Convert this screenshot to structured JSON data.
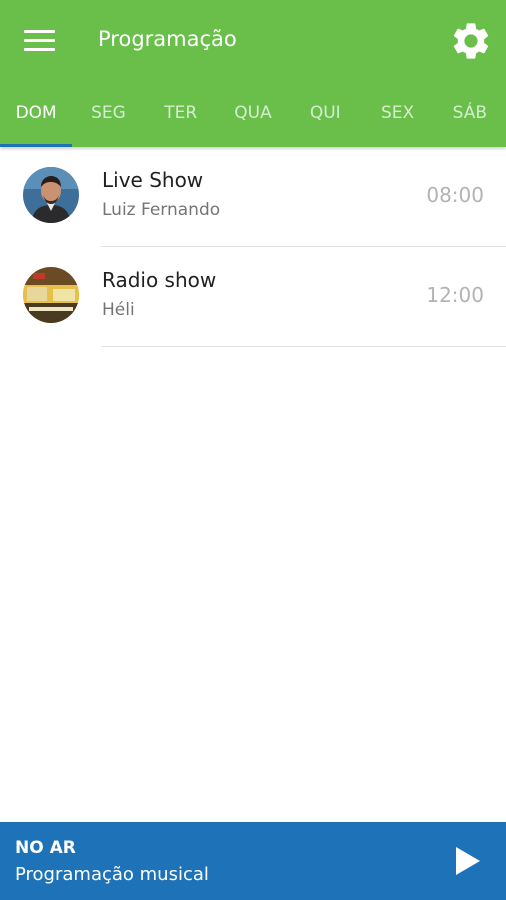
{
  "header": {
    "title": "Programação",
    "menu_icon": "hamburger-menu-icon",
    "settings_icon": "gear-icon",
    "background_color": "#6abf4b"
  },
  "tabs": [
    {
      "label": "DOM",
      "active": true
    },
    {
      "label": "SEG",
      "active": false
    },
    {
      "label": "TER",
      "active": false
    },
    {
      "label": "QUA",
      "active": false
    },
    {
      "label": "QUI",
      "active": false
    },
    {
      "label": "SEX",
      "active": false
    },
    {
      "label": "SÁB",
      "active": false
    }
  ],
  "schedule": [
    {
      "name": "Live Show",
      "host": "Luiz Fernando",
      "time": "08:00",
      "avatar": "host-photo"
    },
    {
      "name": "Radio show",
      "host": "Héli",
      "time": "12:00",
      "avatar": "show-artwork"
    }
  ],
  "player": {
    "label": "NO AR",
    "subtitle": "Programação musical",
    "play_icon": "play-icon",
    "background_color": "#1e72b8"
  }
}
